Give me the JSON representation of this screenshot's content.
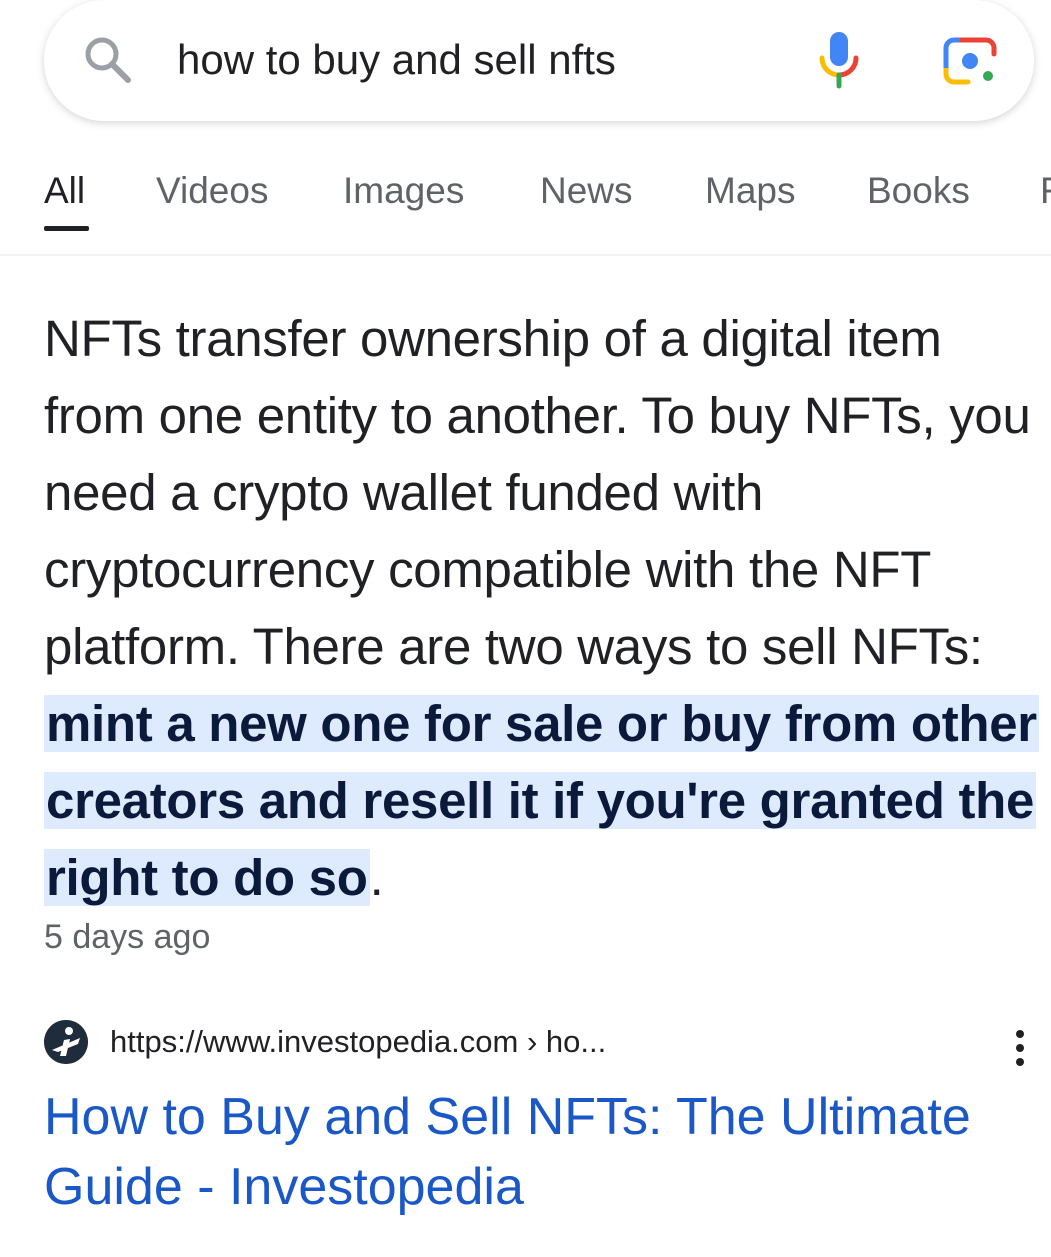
{
  "search": {
    "query": "how to buy and sell nfts"
  },
  "tabs": [
    {
      "label": "All",
      "active": true
    },
    {
      "label": "Videos"
    },
    {
      "label": "Images"
    },
    {
      "label": "News"
    },
    {
      "label": "Maps"
    },
    {
      "label": "Books"
    },
    {
      "label": "F"
    }
  ],
  "snippet": {
    "text_before": "NFTs transfer ownership of a digital item from one entity to another. To buy NFTs, you need a crypto wallet funded with cryptocurrency compatible with the NFT platform. There are two ways to sell NFTs: ",
    "highlight": "mint a new one for sale or buy from other creators and resell it if you're granted the right to do so",
    "text_after": ".",
    "date": "5 days ago"
  },
  "result": {
    "url": "https://www.investopedia.com › ho...",
    "title": "How to Buy and Sell NFTs: The Ultimate Guide - Investopedia"
  },
  "colors": {
    "link": "#1a57c7",
    "highlight": "#d3e3fd",
    "text": "#202124",
    "secondary": "#5f6368"
  },
  "icons": [
    "search-icon",
    "mic-icon",
    "lens-icon",
    "investopedia-favicon",
    "more-vert-icon"
  ]
}
